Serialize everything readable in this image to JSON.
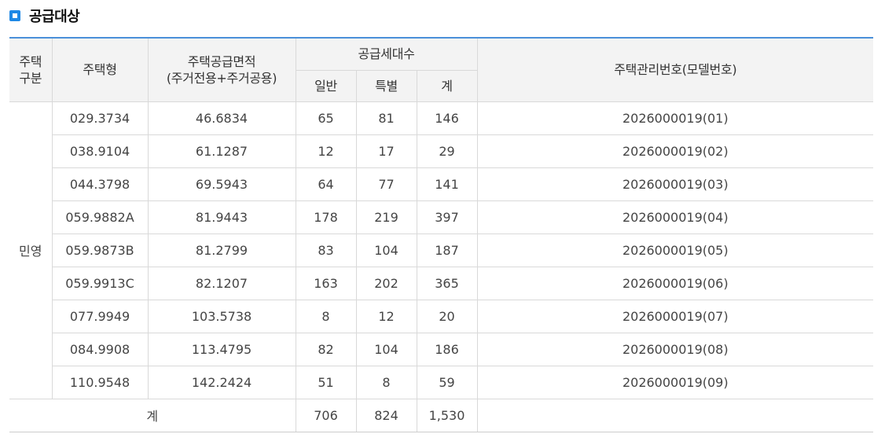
{
  "section": {
    "title": "공급대상",
    "icon": "square-bullet-icon",
    "accent_color": "#1e88e5"
  },
  "table": {
    "headers": {
      "category_line1": "주택",
      "category_line2": "구분",
      "type": "주택형",
      "area_line1": "주택공급면적",
      "area_line2": "(주거전용+주거공용)",
      "households": "공급세대수",
      "general": "일반",
      "special": "특별",
      "total": "계",
      "mgmt": "주택관리번호(모델번호)"
    },
    "category": "민영",
    "rows": [
      {
        "type": "029.3734",
        "area": "46.6834",
        "general": "65",
        "special": "81",
        "total": "146",
        "mgmt": "2026000019(01)"
      },
      {
        "type": "038.9104",
        "area": "61.1287",
        "general": "12",
        "special": "17",
        "total": "29",
        "mgmt": "2026000019(02)"
      },
      {
        "type": "044.3798",
        "area": "69.5943",
        "general": "64",
        "special": "77",
        "total": "141",
        "mgmt": "2026000019(03)"
      },
      {
        "type": "059.9882A",
        "area": "81.9443",
        "general": "178",
        "special": "219",
        "total": "397",
        "mgmt": "2026000019(04)"
      },
      {
        "type": "059.9873B",
        "area": "81.2799",
        "general": "83",
        "special": "104",
        "total": "187",
        "mgmt": "2026000019(05)"
      },
      {
        "type": "059.9913C",
        "area": "82.1207",
        "general": "163",
        "special": "202",
        "total": "365",
        "mgmt": "2026000019(06)"
      },
      {
        "type": "077.9949",
        "area": "103.5738",
        "general": "8",
        "special": "12",
        "total": "20",
        "mgmt": "2026000019(07)"
      },
      {
        "type": "084.9908",
        "area": "113.4795",
        "general": "82",
        "special": "104",
        "total": "186",
        "mgmt": "2026000019(08)"
      },
      {
        "type": "110.9548",
        "area": "142.2424",
        "general": "51",
        "special": "8",
        "total": "59",
        "mgmt": "2026000019(09)"
      }
    ],
    "footer": {
      "label": "계",
      "general": "706",
      "special": "824",
      "total": "1,530",
      "mgmt": ""
    }
  }
}
